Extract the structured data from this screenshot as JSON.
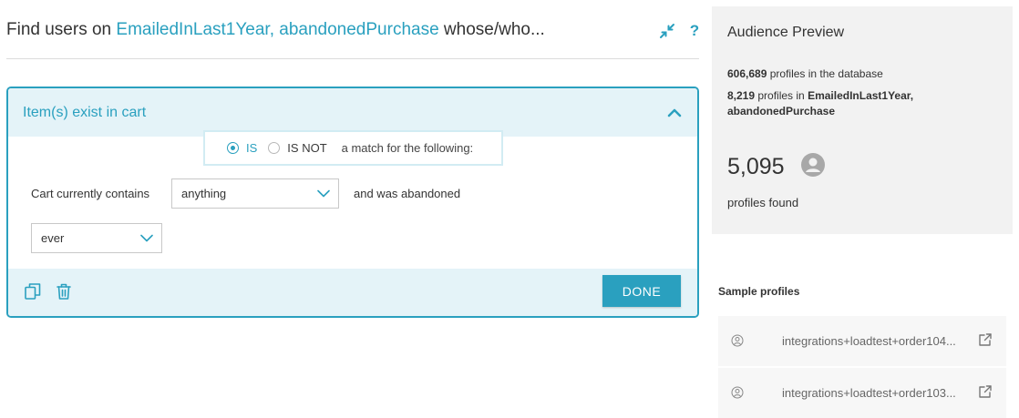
{
  "header": {
    "prefix": "Find users on ",
    "highlight": "EmailedInLast1Year, abandonedPurchase",
    "suffix": " whose/who...",
    "collapse_icon": "collapse-arrows-icon",
    "help_label": "?"
  },
  "card": {
    "title": "Item(s) exist in cart",
    "match": {
      "is_label": "IS",
      "is_not_label": "IS NOT",
      "selected": "IS",
      "text": "a match for the following:"
    },
    "cart_label": "Cart currently contains",
    "cart_select": "anything",
    "abandoned_label": "and was abandoned",
    "time_select": "ever",
    "done_label": "DONE"
  },
  "preview": {
    "title": "Audience Preview",
    "db_count": "606,689",
    "db_text": " profiles in the database",
    "seg_count": "8,219",
    "seg_text": " profiles in ",
    "seg_name_line1": "EmailedInLast1Year,",
    "seg_name_line2": "abandonedPurchase",
    "found_count": "5,095",
    "found_label": "profiles found"
  },
  "samples": {
    "title": "Sample profiles",
    "items": [
      {
        "email": "integrations+loadtest+order104..."
      },
      {
        "email": "integrations+loadtest+order103..."
      }
    ]
  },
  "colors": {
    "accent": "#2aa0bf",
    "panel_bg": "#e4f3f8",
    "side_bg": "#f2f2f2"
  }
}
